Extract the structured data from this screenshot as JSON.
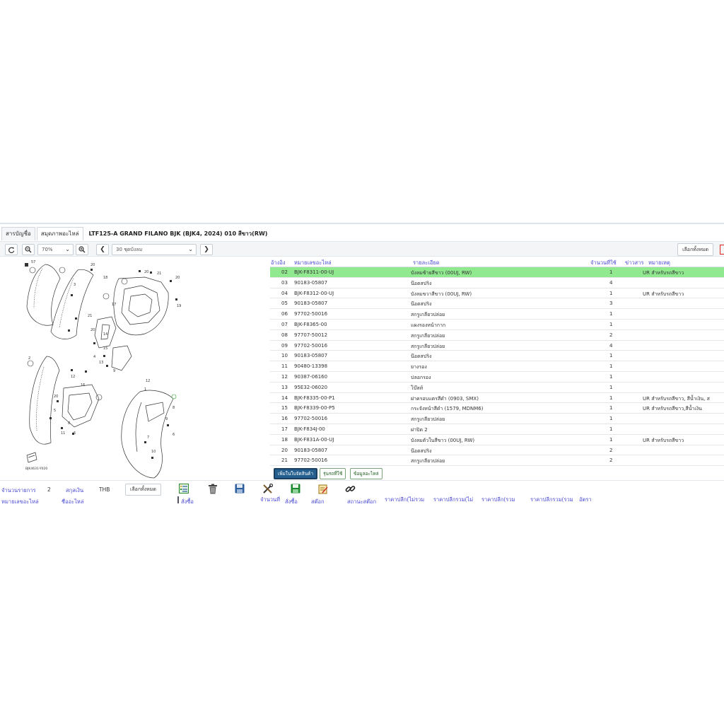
{
  "tabs": [
    {
      "label": "สารบัญชื่อ"
    },
    {
      "label": "สมุดภาพอะไหล่"
    }
  ],
  "page_title": "LTF125-A GRAND FILANO BJK (BJK4, 2024) 010 สีขาว(RW)",
  "toolbar": {
    "zoom": "70%",
    "group": "30 ชุดบังลม",
    "select_all": "เลือกทั้งหมด"
  },
  "diagram": {
    "code": "BJK4631-Y020",
    "callouts": [
      "57",
      "20",
      "18",
      "20",
      "21",
      "20",
      "19",
      "17",
      "21",
      "20",
      "3",
      "14",
      "15",
      "13",
      "4",
      "9",
      "2",
      "12",
      "16",
      "20",
      "5",
      "8",
      "6",
      "11",
      "9",
      "8",
      "10",
      "7",
      "6",
      "12",
      "1"
    ]
  },
  "table": {
    "headers": {
      "ref": "อ้างอิง",
      "part_no": "หมายเลขอะไหล่",
      "desc": "รายละเอียด",
      "qty": "จำนวนที่ใช้",
      "news": "ข่าวสาร",
      "remark": "หมายเหตุ"
    },
    "rows": [
      {
        "ref": "02",
        "pn": "BJK-F8311-00-UJ",
        "desc": "บังลมซ้ายสีขาว (00UJ, RW)",
        "qty": "1",
        "remark": "UR สำหรับรถสีขาว"
      },
      {
        "ref": "03",
        "pn": "90183-05807",
        "desc": "น๊อตสปริง",
        "qty": "4",
        "remark": ""
      },
      {
        "ref": "04",
        "pn": "BJK-F8312-00-UJ",
        "desc": "บังลมขวาสีขาว (00UJ, RW)",
        "qty": "1",
        "remark": "UR สำหรับรถสีขาว"
      },
      {
        "ref": "05",
        "pn": "90183-05807",
        "desc": "น๊อตสปริง",
        "qty": "3",
        "remark": ""
      },
      {
        "ref": "06",
        "pn": "97702-50016",
        "desc": "สกรูเกลียวปล่อย",
        "qty": "1",
        "remark": ""
      },
      {
        "ref": "07",
        "pn": "BJK-F8365-00",
        "desc": "แผงรองหน้ากาก",
        "qty": "1",
        "remark": ""
      },
      {
        "ref": "08",
        "pn": "97707-50012",
        "desc": "สกรูเกลียวปล่อย",
        "qty": "2",
        "remark": ""
      },
      {
        "ref": "09",
        "pn": "97702-50016",
        "desc": "สกรูเกลียวปล่อย",
        "qty": "4",
        "remark": ""
      },
      {
        "ref": "10",
        "pn": "90183-05807",
        "desc": "น๊อตสปริง",
        "qty": "1",
        "remark": ""
      },
      {
        "ref": "11",
        "pn": "90480-13398",
        "desc": "ยางรอง",
        "qty": "1",
        "remark": ""
      },
      {
        "ref": "12",
        "pn": "90387-06160",
        "desc": "ปลอกรอง",
        "qty": "1",
        "remark": ""
      },
      {
        "ref": "13",
        "pn": "95E32-06020",
        "desc": "โบ๊ลท์",
        "qty": "1",
        "remark": ""
      },
      {
        "ref": "14",
        "pn": "BJK-F8335-00-P1",
        "desc": "ฝาครอบแตรสีดำ (0903, SMX)",
        "qty": "1",
        "remark": "UR สำหรับรถสีขาว, สีน้ำเงิน, ส"
      },
      {
        "ref": "15",
        "pn": "BJK-F8339-00-P5",
        "desc": "กระจังหน้าสีดำ (1579, MDNM6)",
        "qty": "1",
        "remark": "UR สำหรับรถสีขาว,สีน้ำเงิน"
      },
      {
        "ref": "16",
        "pn": "97702-50016",
        "desc": "สกรูเกลียวปล่อย",
        "qty": "1",
        "remark": ""
      },
      {
        "ref": "17",
        "pn": "BJK-F834J-00",
        "desc": "ฝาปิด 2",
        "qty": "1",
        "remark": ""
      },
      {
        "ref": "18",
        "pn": "BJK-F831A-00-UJ",
        "desc": "บังลมตัวในสีขาว (00UJ, RW)",
        "qty": "1",
        "remark": "UR สำหรับรถสีขาว"
      },
      {
        "ref": "20",
        "pn": "90183-05807",
        "desc": "น๊อตสปริง",
        "qty": "2",
        "remark": ""
      },
      {
        "ref": "21",
        "pn": "97702-50016",
        "desc": "สกรูเกลียวปล่อย",
        "qty": "2",
        "remark": ""
      }
    ]
  },
  "actions": {
    "add_to_basket": "เพิ่มในใบจัดสินค้า",
    "models_used": "รุ่นรถที่ใช้",
    "part_info": "ข้อมูลอะไหล่"
  },
  "basket": {
    "item_count_label": "จำนวนรายการ",
    "item_count": "2",
    "currency_label": "สกุลเงิน",
    "currency": "THB",
    "select_all": "เลือกทั้งหมด",
    "headers": {
      "part_no": "หมายเลขอะไหล่",
      "part_name": "ชื่ออะไหล่",
      "order_qty": "สั่งซื้อ",
      "qty": "จำนวนที่",
      "order": "สั่งซื้อ",
      "stock": "สต๊อก",
      "stock_status": "สถานะสต๊อก",
      "retail_excl": "ราคาปลีก(ไม่รวม",
      "retail_total_excl": "ราคาปลีกรวม(ไม่",
      "retail_incl": "ราคาปลีก(รวม",
      "retail_total_incl": "ราคาปลีกรวม(รวม",
      "rate": "อัตรา"
    }
  },
  "colors": {
    "selected_row": "#90e88f",
    "header_text": "#4a4ad2",
    "primary_button": "#245f8f"
  }
}
